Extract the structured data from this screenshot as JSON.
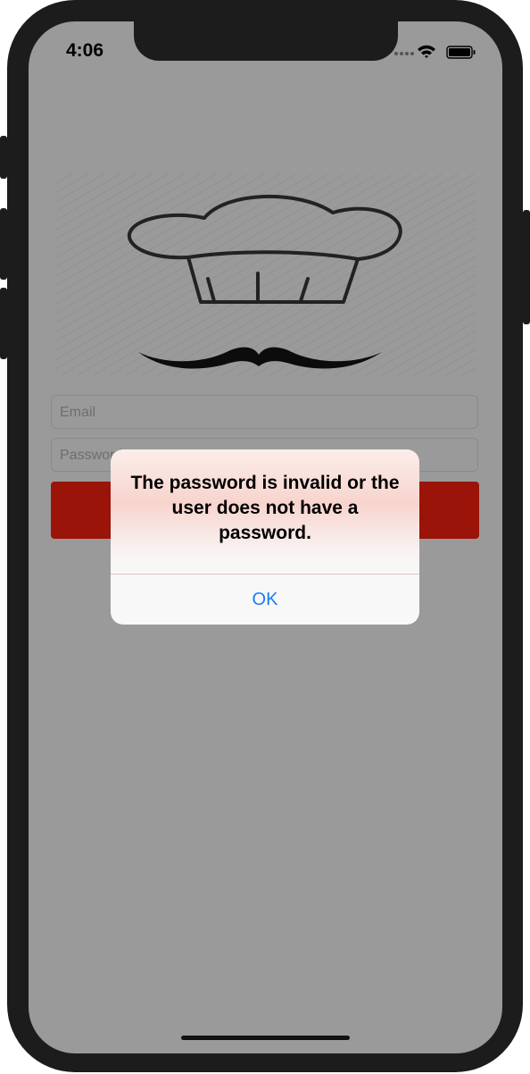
{
  "status_bar": {
    "time": "4:06"
  },
  "login_form": {
    "email_placeholder": "Email",
    "password_placeholder": "Password",
    "login_button_color": "#9a1409"
  },
  "alert": {
    "message": "The password is invalid or the user does not have a password.",
    "ok_label": "OK"
  },
  "colors": {
    "screen_dim": "#9a9a9a",
    "ok_blue": "#1b7cf0"
  },
  "icons": [
    "signal-dots-icon",
    "wifi-icon",
    "battery-icon",
    "chef-hat-logo",
    "mustache-logo"
  ]
}
